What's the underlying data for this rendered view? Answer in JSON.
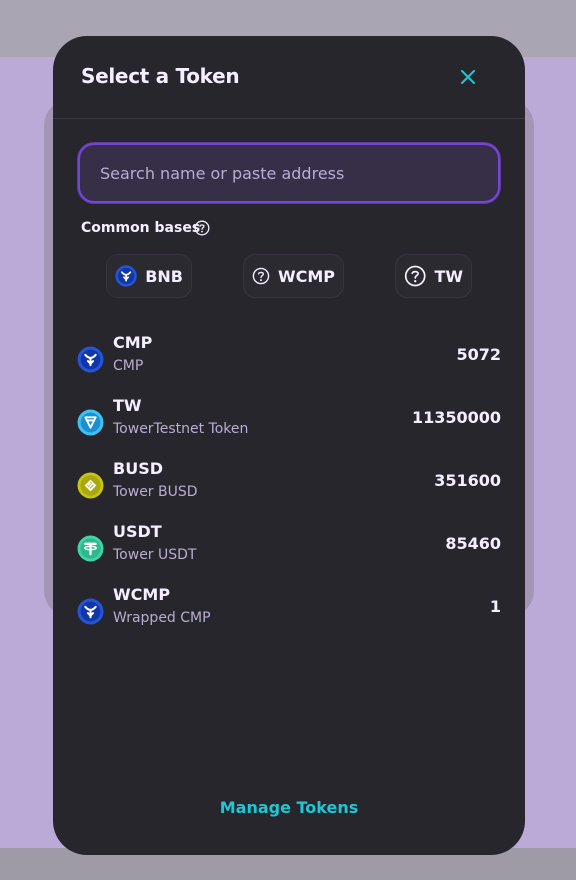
{
  "modal": {
    "title": "Select a Token",
    "close_icon": "close-icon",
    "accent_color": "#1fc7d4"
  },
  "search": {
    "placeholder": "Search name or paste address",
    "value": ""
  },
  "common_bases": {
    "label": "Common bases",
    "help_icon": "question-circle-icon",
    "items": [
      {
        "symbol": "BNB",
        "icon": "cmp-token-icon"
      },
      {
        "symbol": "WCMP",
        "icon": "question-circle-icon"
      },
      {
        "symbol": "TW",
        "icon": "question-circle-icon"
      }
    ]
  },
  "tokens": [
    {
      "symbol": "CMP",
      "name": "CMP",
      "balance": "5072",
      "icon": "cmp-token-icon"
    },
    {
      "symbol": "TW",
      "name": "TowerTestnet Token",
      "balance": "11350000",
      "icon": "tw-token-icon"
    },
    {
      "symbol": "BUSD",
      "name": "Tower BUSD",
      "balance": "351600",
      "icon": "busd-token-icon"
    },
    {
      "symbol": "USDT",
      "name": "Tower USDT",
      "balance": "85460",
      "icon": "usdt-token-icon"
    },
    {
      "symbol": "WCMP",
      "name": "Wrapped CMP",
      "balance": "1",
      "icon": "cmp-token-icon"
    }
  ],
  "footer": {
    "manage_label": "Manage Tokens"
  }
}
